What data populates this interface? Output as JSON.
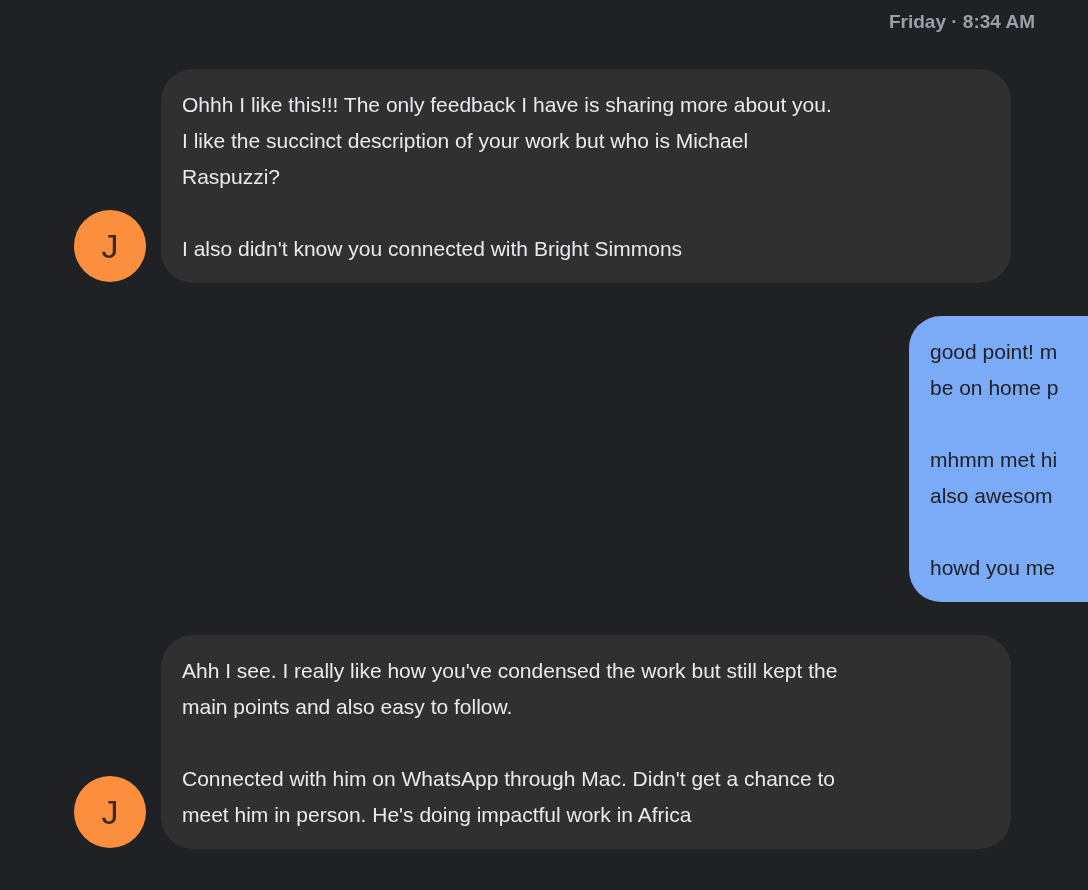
{
  "timestamp": "Friday · 8:34 AM",
  "messages": [
    {
      "kind": "received",
      "avatar": "J",
      "paragraphs": [
        "Ohhh I like this!!! The only feedback I have is sharing more about you.\nI like the succinct description of your work but who is Michael\nRaspuzzi?",
        "I also didn't know you connected with Bright Simmons"
      ]
    },
    {
      "kind": "sent",
      "paragraphs": [
        "good point! m\nbe on home p",
        "mhmm met hi\nalso awesom",
        "howd you me"
      ]
    },
    {
      "kind": "received",
      "avatar": "J",
      "paragraphs": [
        "Ahh I see. I really like how you've condensed the work but still kept the\nmain points and also easy to follow.",
        "Connected with him on WhatsApp through Mac. Didn't get a chance to\nmeet him in person. He's doing impactful work in Africa"
      ]
    }
  ]
}
